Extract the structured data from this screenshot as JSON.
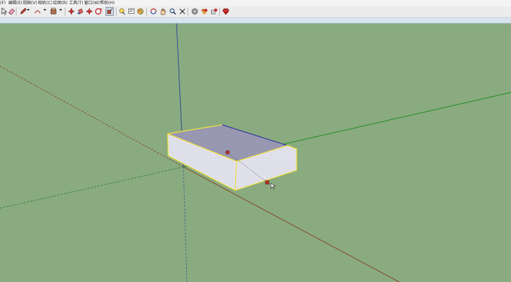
{
  "menubar": {
    "items": [
      {
        "label": "(F)"
      },
      {
        "label": "编辑(E)"
      },
      {
        "label": "视图(V)"
      },
      {
        "label": "相机(C)"
      },
      {
        "label": "绘图(R)"
      },
      {
        "label": "工具(T)"
      },
      {
        "label": "窗口(W)"
      },
      {
        "label": "帮助(H)"
      }
    ]
  },
  "toolbar": {
    "tools": [
      {
        "name": "select-tool",
        "icon": "arrow-icon"
      },
      {
        "name": "eraser-tool",
        "icon": "eraser-icon"
      },
      {
        "name": "pencil-tool",
        "icon": "pencil-icon"
      },
      {
        "name": "shape-tool",
        "icon": "arc-icon"
      },
      {
        "name": "pushpull-tool",
        "icon": "pushpull-icon"
      },
      {
        "name": "move-tool",
        "icon": "move-icon"
      },
      {
        "name": "paint-tool",
        "icon": "paint-bucket-icon"
      },
      {
        "name": "rotate-tool",
        "icon": "rotate-icon"
      },
      {
        "name": "offset-tool",
        "icon": "offset-icon"
      },
      {
        "name": "scale-tool",
        "icon": "scale-icon"
      },
      {
        "name": "tape-tool",
        "icon": "tape-measure-icon"
      },
      {
        "name": "text-tool",
        "icon": "text-icon"
      },
      {
        "name": "paint-tool-2",
        "icon": "paint-icon"
      },
      {
        "name": "orbit-tool",
        "icon": "orbit-icon"
      },
      {
        "name": "pan-tool",
        "icon": "pan-hand-icon"
      },
      {
        "name": "zoom-tool",
        "icon": "zoom-icon"
      },
      {
        "name": "zoom-extents-tool",
        "icon": "zoom-extents-icon"
      },
      {
        "name": "warehouse-tool",
        "icon": "warehouse-icon"
      },
      {
        "name": "components-tool",
        "icon": "components-icon"
      },
      {
        "name": "share-tool",
        "icon": "share-model-icon"
      },
      {
        "name": "ruby-tool",
        "icon": "ruby-icon"
      }
    ]
  },
  "colors": {
    "ground": "#89ab7f",
    "axis_red": "#8b3a1f",
    "axis_green": "#1f8a1f",
    "axis_blue": "#2a3d9a",
    "top_face": "#9898b0",
    "side_face": "#e8e8f0",
    "selection": "#f0e040",
    "inference": "#c03030"
  }
}
